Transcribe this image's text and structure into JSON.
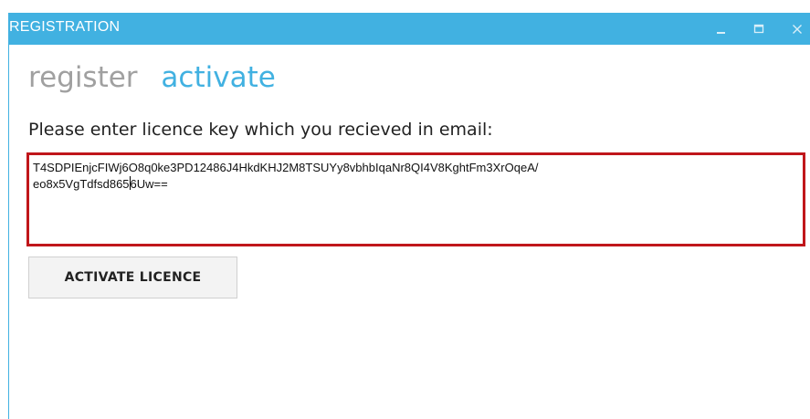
{
  "window": {
    "title": "REGISTRATION",
    "accent_color": "#41b1e1",
    "controls": [
      "minimize-icon",
      "maximize-icon",
      "close-icon"
    ]
  },
  "tabs": [
    {
      "label": "register",
      "active": false
    },
    {
      "label": "activate",
      "active": true
    }
  ],
  "form": {
    "prompt": "Please enter licence key which you recieved in email:",
    "licence_key_line1": "T4SDPIEnjcFIWj6O8q0ke3PD12486J4HkdKHJ2M8TSUYy8vbhbIqaNr8QI4V8KghtFm3XrOqeA/",
    "licence_key_line2_before_caret": "eo8x5VgTdfsd865",
    "licence_key_line2_after_caret": "6Uw==",
    "field_border_color": "#c0161b",
    "activate_button": "ACTIVATE LICENCE"
  }
}
